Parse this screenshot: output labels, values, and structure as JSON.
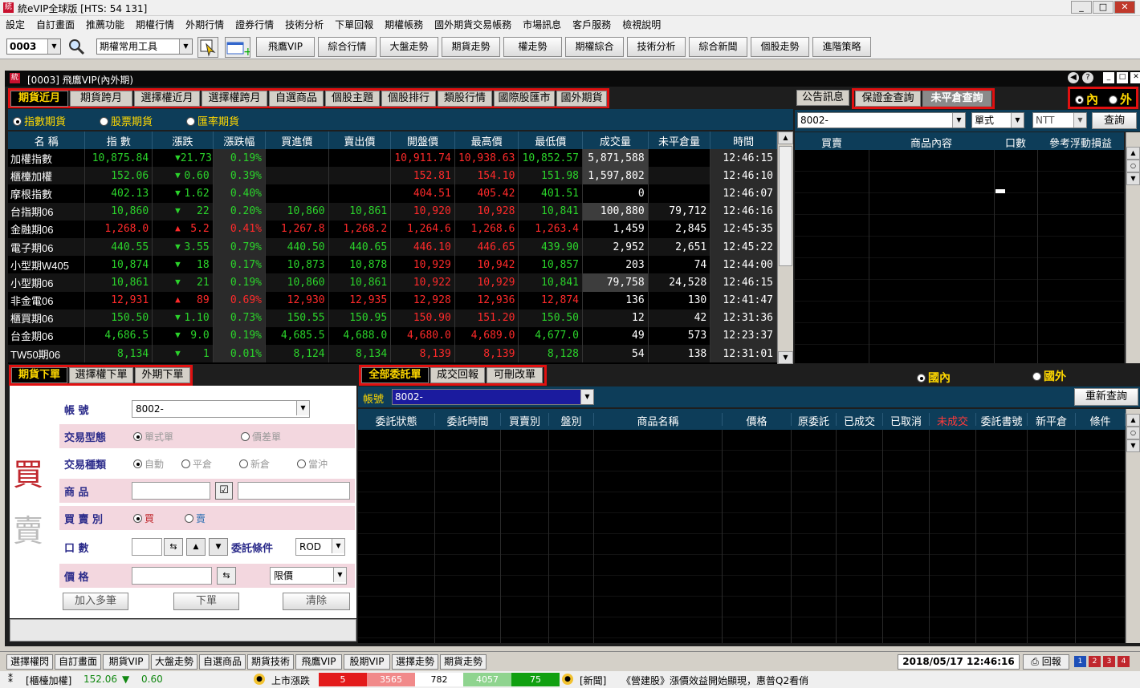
{
  "window": {
    "title": "統eVIP全球版 [HTS: 54 131]"
  },
  "menu": [
    "設定",
    "自訂畫面",
    "推薦功能",
    "期權行情",
    "外期行情",
    "證券行情",
    "技術分析",
    "下單回報",
    "期權帳務",
    "國外期貨交易帳務",
    "市場訊息",
    "客戶服務",
    "檢視說明"
  ],
  "toolbar": {
    "stock_code": "0003",
    "tool_select": "期權常用工具",
    "buttons": [
      "飛鷹VIP",
      "綜合行情",
      "大盤走勢",
      "期貨走勢",
      "權走勢",
      "期權綜合",
      "技術分析",
      "綜合新聞",
      "個股走勢",
      "進階策略"
    ]
  },
  "inner_title": "[0003] 飛鷹VIP(內外期)",
  "quote_tabs": [
    "期貨近月",
    "期貨跨月",
    "選擇權近月",
    "選擇權跨月",
    "自選商品",
    "個股主題",
    "個股排行",
    "類股行情",
    "國際股匯市",
    "國外期貨"
  ],
  "quote_filters": [
    "指數期貨",
    "股票期貨",
    "匯率期貨"
  ],
  "quote_columns": [
    "名 稱",
    "指 數",
    "漲跌",
    "漲跌幅",
    "買進價",
    "賣出價",
    "開盤價",
    "最高價",
    "最低價",
    "成交量",
    "未平倉量",
    "時間"
  ],
  "quote_rows": [
    {
      "name": "加權指數",
      "idx": "10,875.84",
      "dir": "down",
      "chg": "21.73",
      "pct": "0.19%",
      "bid": "",
      "ask": "",
      "open": "10,911.74",
      "high": "10,938.63",
      "low": "10,852.57",
      "vol": "5,871,588",
      "oi": "",
      "time": "12:46:15"
    },
    {
      "name": "櫃檯加權",
      "idx": "152.06",
      "dir": "down",
      "chg": "0.60",
      "pct": "0.39%",
      "bid": "",
      "ask": "",
      "open": "152.81",
      "high": "154.10",
      "low": "151.98",
      "vol": "1,597,802",
      "oi": "",
      "time": "12:46:10"
    },
    {
      "name": "摩根指數",
      "idx": "402.13",
      "dir": "down",
      "chg": "1.62",
      "pct": "0.40%",
      "bid": "",
      "ask": "",
      "open": "404.51",
      "high": "405.42",
      "low": "401.51",
      "vol": "0",
      "oi": "",
      "time": "12:46:07"
    },
    {
      "name": "台指期06",
      "idx": "10,860",
      "dir": "down",
      "chg": "22",
      "pct": "0.20%",
      "bid": "10,860",
      "ask": "10,861",
      "open": "10,920",
      "high": "10,928",
      "low": "10,841",
      "vol": "100,880",
      "oi": "79,712",
      "time": "12:46:16"
    },
    {
      "name": "金融期06",
      "idx": "1,268.0",
      "dir": "up",
      "chg": "5.2",
      "pct": "0.41%",
      "bid": "1,267.8",
      "ask": "1,268.2",
      "open": "1,264.6",
      "high": "1,268.6",
      "low": "1,263.4",
      "vol": "1,459",
      "oi": "2,845",
      "time": "12:45:35"
    },
    {
      "name": "電子期06",
      "idx": "440.55",
      "dir": "down",
      "chg": "3.55",
      "pct": "0.79%",
      "bid": "440.50",
      "ask": "440.65",
      "open": "446.10",
      "high": "446.65",
      "low": "439.90",
      "vol": "2,952",
      "oi": "2,651",
      "time": "12:45:22"
    },
    {
      "name": "小型期W405",
      "idx": "10,874",
      "dir": "down",
      "chg": "18",
      "pct": "0.17%",
      "bid": "10,873",
      "ask": "10,878",
      "open": "10,929",
      "high": "10,942",
      "low": "10,857",
      "vol": "203",
      "oi": "74",
      "time": "12:44:00"
    },
    {
      "name": "小型期06",
      "idx": "10,861",
      "dir": "down",
      "chg": "21",
      "pct": "0.19%",
      "bid": "10,860",
      "ask": "10,861",
      "open": "10,922",
      "high": "10,929",
      "low": "10,841",
      "vol": "79,758",
      "oi": "24,528",
      "time": "12:46:15"
    },
    {
      "name": "非金電06",
      "idx": "12,931",
      "dir": "up",
      "chg": "89",
      "pct": "0.69%",
      "bid": "12,930",
      "ask": "12,935",
      "open": "12,928",
      "high": "12,936",
      "low": "12,874",
      "vol": "136",
      "oi": "130",
      "time": "12:41:47"
    },
    {
      "name": "櫃買期06",
      "idx": "150.50",
      "dir": "down",
      "chg": "1.10",
      "pct": "0.73%",
      "bid": "150.55",
      "ask": "150.95",
      "open": "150.90",
      "high": "151.20",
      "low": "150.50",
      "vol": "12",
      "oi": "42",
      "time": "12:31:36"
    },
    {
      "name": "台金期06",
      "idx": "4,686.5",
      "dir": "down",
      "chg": "9.0",
      "pct": "0.19%",
      "bid": "4,685.5",
      "ask": "4,688.0",
      "open": "4,680.0",
      "high": "4,689.0",
      "low": "4,677.0",
      "vol": "49",
      "oi": "573",
      "time": "12:23:37"
    },
    {
      "name": "TW50期06",
      "idx": "8,134",
      "dir": "down",
      "chg": "1",
      "pct": "0.01%",
      "bid": "8,124",
      "ask": "8,134",
      "open": "8,139",
      "high": "8,139",
      "low": "8,128",
      "vol": "54",
      "oi": "138",
      "time": "12:31:01"
    }
  ],
  "right_panel": {
    "tabs": [
      "公告訊息",
      "保證金查詢",
      "未平倉查詢"
    ],
    "market_radio": [
      "內",
      "外"
    ],
    "account": "8002-",
    "mode": "單式",
    "currency": "NTT",
    "query": "查詢",
    "columns": [
      "買賣",
      "商品內容",
      "口數",
      "參考浮動損益"
    ]
  },
  "order_tabs": [
    "期貨下單",
    "選擇權下單",
    "外期下單"
  ],
  "order_form": {
    "buy_glyph": "買",
    "sell_glyph": "賣",
    "account_label": "帳 號",
    "account": "8002-",
    "trade_type_label": "交易型態",
    "trade_types": [
      "單式單",
      "價差單"
    ],
    "category_label": "交易種類",
    "categories": [
      "自動",
      "平倉",
      "新倉",
      "當沖"
    ],
    "product_label": "商 品",
    "side_label": "買 賣 別",
    "side_buy": "買",
    "side_sell": "賣",
    "qty_label": "口 數",
    "condition_label": "委託條件",
    "condition": "ROD",
    "price_label": "價 格",
    "price_type": "限價",
    "add_button": "加入多筆",
    "submit_button": "下單",
    "clear_button": "清除"
  },
  "orders": {
    "tabs": [
      "全部委託單",
      "成交回報",
      "可刪改單"
    ],
    "market_radio": [
      "國內",
      "國外"
    ],
    "account_label": "帳號",
    "account": "8002-",
    "requery": "重新查詢",
    "columns": [
      "委託狀態",
      "委託時間",
      "買賣別",
      "盤別",
      "商品名稱",
      "價格",
      "原委託",
      "已成交",
      "已取消",
      "未成交",
      "委託書號",
      "新平倉",
      "條件"
    ]
  },
  "bottom_buttons": [
    "選擇權閃",
    "自訂畫面",
    "期貨VIP",
    "大盤走勢",
    "自選商品",
    "期貨技術",
    "飛鷹VIP",
    "股期VIP",
    "選擇走勢",
    "期貨走勢"
  ],
  "datetime": "2018/05/17 12:46:16",
  "report_btn": "回報",
  "ticker": {
    "index_name": "[櫃檯加權]",
    "index_value": "152.06",
    "index_dir": "▼",
    "index_chg": "0.60",
    "listed_label": "上市漲跌",
    "counts": [
      "5",
      "3565",
      "782",
      "4057",
      "75"
    ],
    "news_label": "[新聞]",
    "news": "《營建股》漲價效益開始顯現，惠普Q2看俏"
  }
}
